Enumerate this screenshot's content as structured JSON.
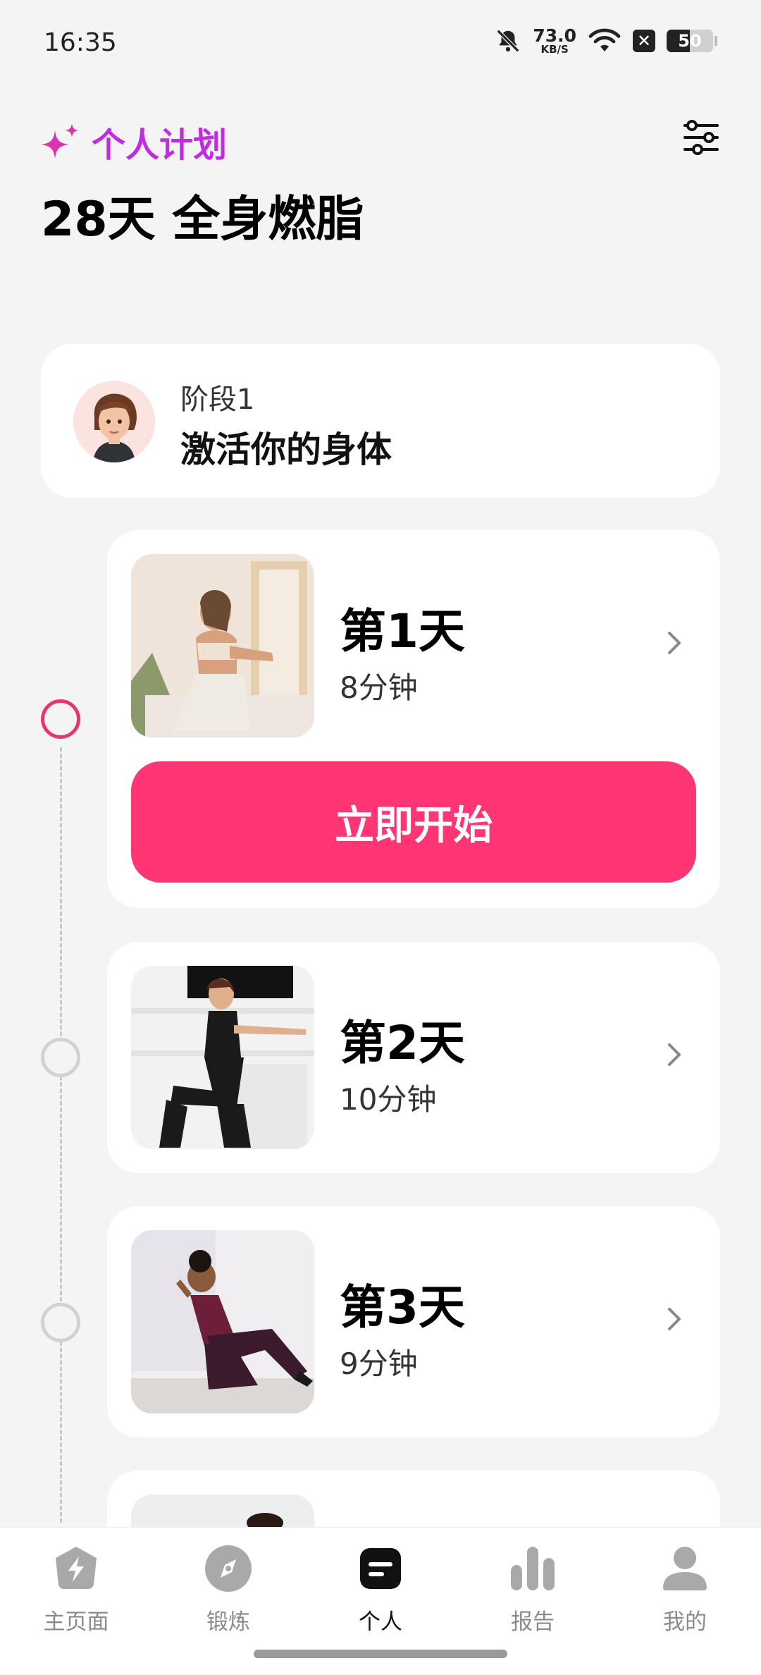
{
  "status_bar": {
    "time": "16:35",
    "net_speed": "73.0",
    "net_unit": "KB/S",
    "battery": "50",
    "battery_level_percent": 50,
    "icons": [
      "bell-muted-icon",
      "wifi-icon",
      "x-box-icon",
      "battery-icon"
    ]
  },
  "header": {
    "plan_tag": "个人计划",
    "plan_title": "28天 全身燃脂",
    "accent_gradient": [
      "#ff2f7d",
      "#9b3be8"
    ]
  },
  "stage": {
    "label": "阶段1",
    "name": "激活你的身体"
  },
  "days": [
    {
      "title": "第1天",
      "duration": "8分钟",
      "active": true
    },
    {
      "title": "第2天",
      "duration": "10分钟",
      "active": false
    },
    {
      "title": "第3天",
      "duration": "9分钟",
      "active": false
    }
  ],
  "start_button": "立即开始",
  "bottom_nav": [
    {
      "label": "主页面",
      "icon": "home-bolt-icon",
      "active": false
    },
    {
      "label": "锻炼",
      "icon": "compass-icon",
      "active": false
    },
    {
      "label": "个人",
      "icon": "plan-icon",
      "active": true
    },
    {
      "label": "报告",
      "icon": "bar-chart-icon",
      "active": false
    },
    {
      "label": "我的",
      "icon": "profile-icon",
      "active": false
    }
  ],
  "colors": {
    "primary": "#ff3574",
    "timeline_active": "#e83472",
    "background": "#f4f4f4"
  }
}
